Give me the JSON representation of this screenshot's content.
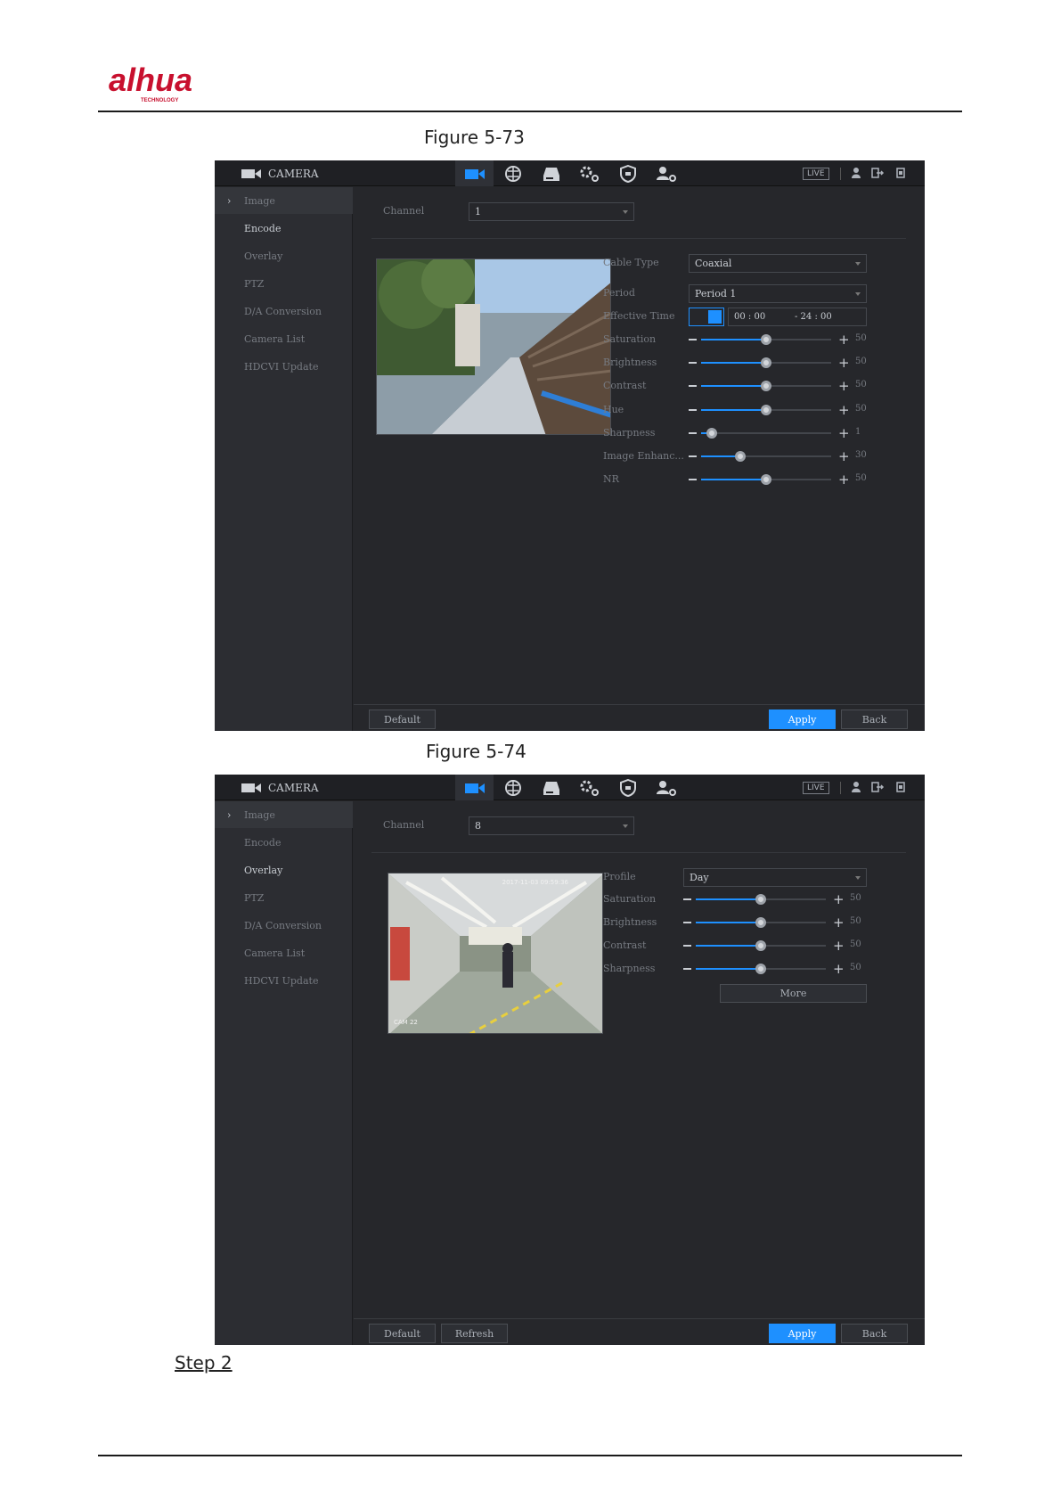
{
  "brand": {
    "logo_text": "alhua",
    "logo_sub": "TECHNOLOGY",
    "color": "#c8102e"
  },
  "captions": {
    "fig73": "Figure 5-73",
    "fig74": "Figure 5-74",
    "step": "Step 2"
  },
  "colors": {
    "accent": "#1e90ff",
    "panel_bg": "#26272b",
    "sidebar_bg": "#2c2d32",
    "topbar_bg": "#1f2024"
  },
  "topbar": {
    "title": "CAMERA",
    "icons": [
      "camera-icon",
      "network-icon",
      "storage-icon",
      "system-settings-icon",
      "security-shield-icon",
      "account-settings-icon"
    ],
    "live_label": "LIVE"
  },
  "sidebar": {
    "items": [
      {
        "label": "Image"
      },
      {
        "label": "Encode"
      },
      {
        "label": "Overlay"
      },
      {
        "label": "PTZ"
      },
      {
        "label": "D/A Conversion"
      },
      {
        "label": "Camera List"
      },
      {
        "label": "HDCVI Update"
      }
    ]
  },
  "fig73": {
    "channel_label": "Channel",
    "channel_value": "1",
    "cable_type_label": "Cable Type",
    "cable_type_value": "Coaxial",
    "period_label": "Period",
    "period_value": "Period 1",
    "effective_time_label": "Effective Time",
    "effective_time_start": "00 : 00",
    "effective_time_end": "- 24 : 00",
    "sliders": [
      {
        "label": "Saturation",
        "value": "50",
        "fraction": 0.5
      },
      {
        "label": "Brightness",
        "value": "50",
        "fraction": 0.5
      },
      {
        "label": "Contrast",
        "value": "50",
        "fraction": 0.5
      },
      {
        "label": "Hue",
        "value": "50",
        "fraction": 0.5
      },
      {
        "label": "Sharpness",
        "value": "1",
        "fraction": 0.08
      },
      {
        "label": "Image Enhanc...",
        "value": "30",
        "fraction": 0.3
      },
      {
        "label": "NR",
        "value": "50",
        "fraction": 0.5
      }
    ],
    "buttons": {
      "default": "Default",
      "apply": "Apply",
      "back": "Back"
    }
  },
  "fig74": {
    "channel_label": "Channel",
    "channel_value": "8",
    "profile_label": "Profile",
    "profile_value": "Day",
    "sliders": [
      {
        "label": "Saturation",
        "value": "50",
        "fraction": 0.5
      },
      {
        "label": "Brightness",
        "value": "50",
        "fraction": 0.5
      },
      {
        "label": "Contrast",
        "value": "50",
        "fraction": 0.5
      },
      {
        "label": "Sharpness",
        "value": "50",
        "fraction": 0.5
      }
    ],
    "more_label": "More",
    "preview_timestamp": "2017-11-03 09:59:36",
    "preview_channel": "CAM 22",
    "buttons": {
      "default": "Default",
      "refresh": "Refresh",
      "apply": "Apply",
      "back": "Back"
    }
  }
}
